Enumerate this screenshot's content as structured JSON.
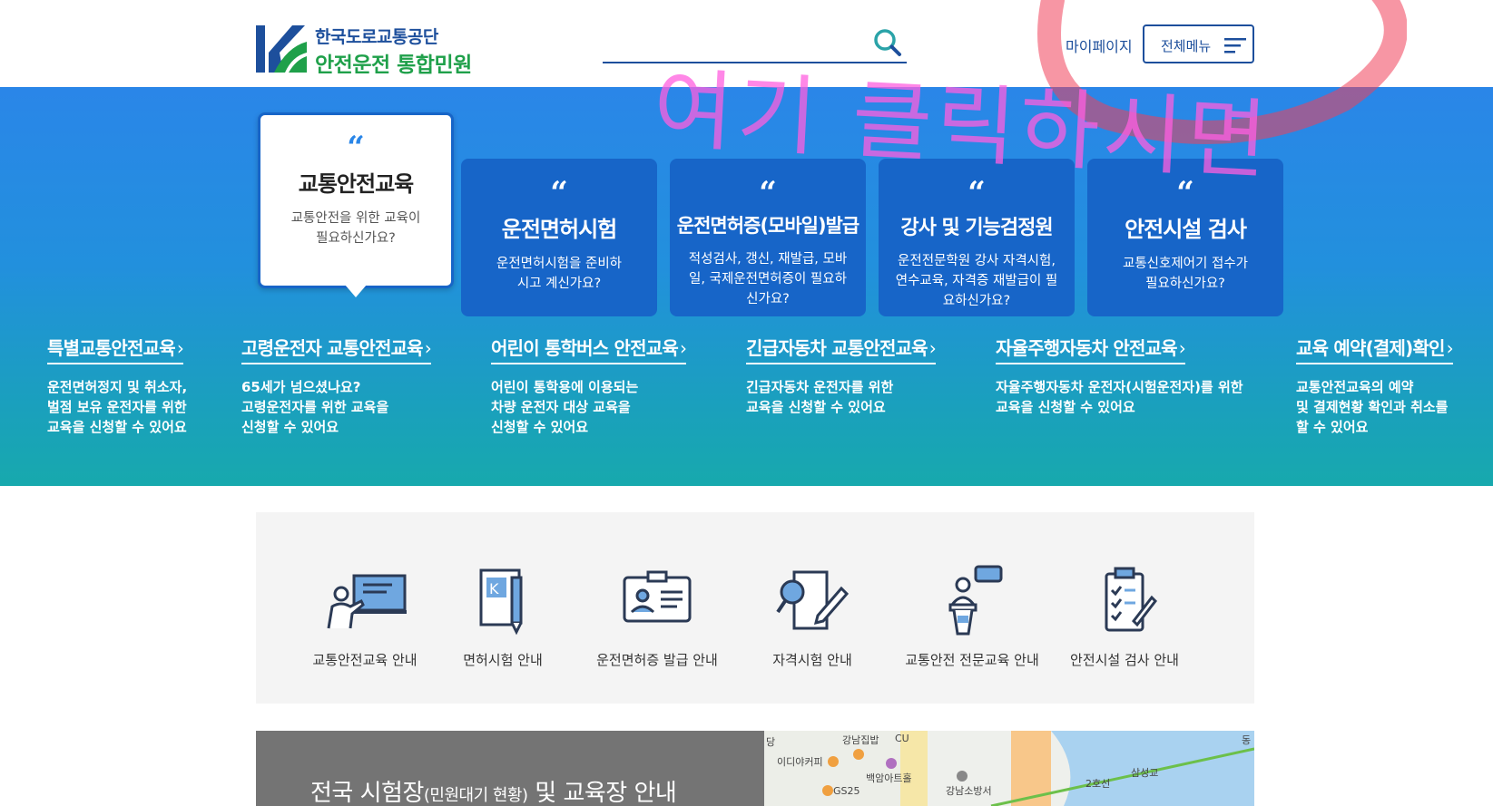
{
  "header": {
    "logo_line1": "한국도로교통공단",
    "logo_line2": "안전운전 통합민원",
    "search_placeholder": "",
    "mypage": "마이페이지",
    "all_menu": "전체메뉴"
  },
  "main_cards": [
    {
      "title": "교통안전교육",
      "desc": "교통안전을 위한 교육이 필요하신가요?",
      "active": true
    },
    {
      "title": "운전면허시험",
      "desc": "운전면허시험을 준비하시고 계신가요?"
    },
    {
      "title": "운전면허증(모바일)발급",
      "desc": "적성검사, 갱신, 재발급, 모바일, 국제운전면허증이 필요하신가요?"
    },
    {
      "title": "강사 및 기능검정원",
      "desc": "운전전문학원 강사 자격시험, 연수교육, 자격증 재발급이 필요하신가요?"
    },
    {
      "title": "안전시설 검사",
      "desc": "교통신호제어기 접수가 필요하신가요?"
    }
  ],
  "quote_mark": "“",
  "sub_links": [
    {
      "title": "특별교통안전교육",
      "desc": [
        "운전면허정지 및 취소자,",
        "벌점 보유 운전자를 위한",
        "교육을 신청할 수 있어요"
      ]
    },
    {
      "title": "고령운전자 교통안전교육",
      "desc": [
        "65세가 넘으셨나요?",
        "고령운전자를 위한 교육을",
        "신청할 수 있어요"
      ]
    },
    {
      "title": "어린이 통학버스 안전교육",
      "desc": [
        "어린이 통학용에 이용되는",
        "차량 운전자 대상 교육을",
        "신청할 수 있어요"
      ]
    },
    {
      "title": "긴급자동차 교통안전교육",
      "desc": [
        "긴급자동차 운전자를 위한",
        "교육을 신청할 수 있어요"
      ]
    },
    {
      "title": "자율주행자동차 안전교육",
      "desc": [
        "자율주행자동차 운전자(시험운전자)를 위한",
        "교육을 신청할 수 있어요"
      ]
    },
    {
      "title": "교육 예약(결제)확인",
      "desc": [
        "교통안전교육의 예약",
        "및 결제현황 확인과 취소를",
        "할 수 있어요"
      ]
    }
  ],
  "arrow": "›",
  "overlay_text": "여기 클릭하시면",
  "guide_items": [
    {
      "label": "교통안전교육 안내",
      "icon": "teacher-board-icon"
    },
    {
      "label": "면허시험 안내",
      "icon": "license-book-pen-icon"
    },
    {
      "label": "운전면허증 발급 안내",
      "icon": "id-card-icon"
    },
    {
      "label": "자격시험 안내",
      "icon": "exam-magnifier-icon"
    },
    {
      "label": "교통안전 전문교육 안내",
      "icon": "speaker-podium-icon"
    },
    {
      "label": "안전시설 검사 안내",
      "icon": "clipboard-checklist-icon"
    }
  ],
  "bottom": {
    "title_main": "전국 시험장",
    "title_small": "(민원대기 현황)",
    "title_end": " 및 교육장 안내"
  },
  "map_labels": [
    "강남집밥",
    "CU",
    "이디야커피",
    "백암아트홀",
    "GS25",
    "강남소방서",
    "삼성교",
    "2호선",
    "당",
    "동"
  ],
  "colors": {
    "primary_blue": "#1d4f9c",
    "logo_green": "#1fa04a",
    "card_blue": "#1765c8",
    "overlay_pink": "#ff5fe0"
  }
}
